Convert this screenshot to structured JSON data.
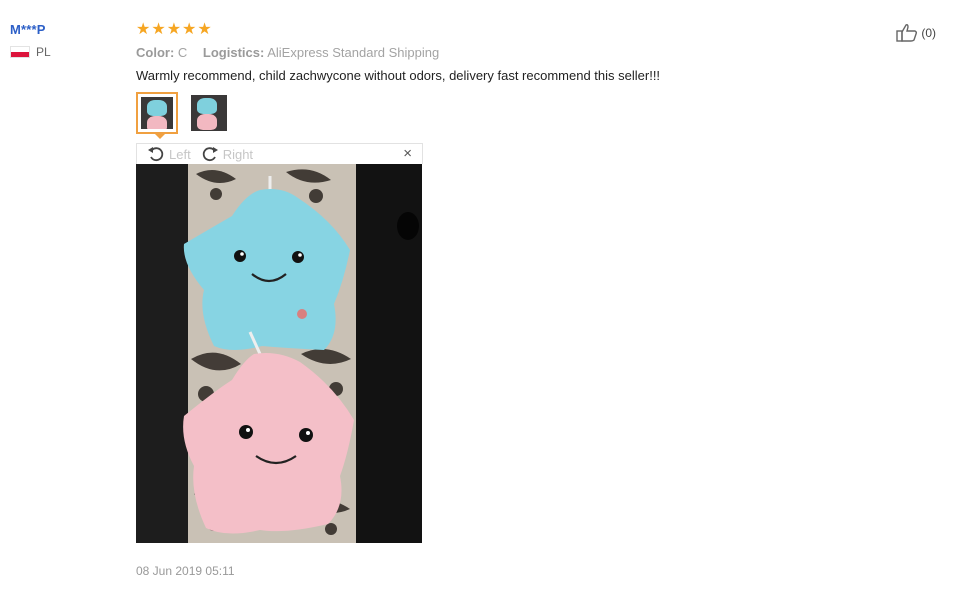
{
  "review": {
    "user": {
      "name": "M***P",
      "country": "PL"
    },
    "rating_stars": 5,
    "stars": [
      "★",
      "★",
      "★",
      "★",
      "★"
    ],
    "color_label": "Color:",
    "color_value": "C",
    "logistics_label": "Logistics:",
    "logistics_value": "AliExpress Standard Shipping",
    "text": "Warmly recommend, child zachwycone without odors, delivery fast recommend this seller!!!",
    "date": "08 Jun 2019 05:11",
    "helpful_count": "(0)",
    "accent_color": "#f6a623"
  },
  "viewer": {
    "left_label": "Left",
    "right_label": "Right",
    "close_label": "×",
    "selected_thumb": 1
  },
  "icons": [
    "thumbs-up-icon",
    "rotate-left-icon",
    "rotate-right-icon",
    "close-icon",
    "flag-pl-icon"
  ]
}
